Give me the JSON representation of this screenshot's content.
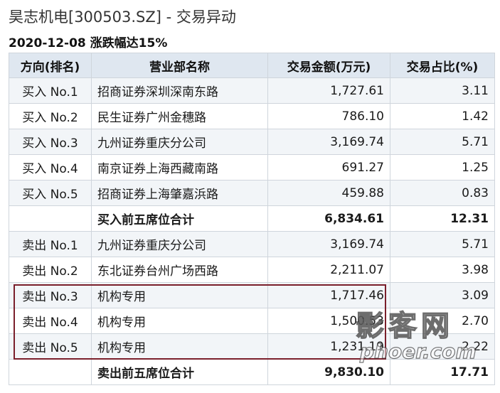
{
  "header": {
    "title": "昊志机电[300503.SZ] - 交易异动",
    "subtitle": "2020-12-08 涨跌幅达15%"
  },
  "table": {
    "columns": [
      "方向(排名)",
      "营业部名称",
      "交易金额(万元)",
      "交易占比(%)"
    ],
    "rows": [
      {
        "direction": "买入 No.1",
        "branch": "招商证券深圳深南东路",
        "amount": "1,727.61",
        "ratio": "3.11"
      },
      {
        "direction": "买入 No.2",
        "branch": "民生证券广州金穗路",
        "amount": "786.10",
        "ratio": "1.42"
      },
      {
        "direction": "买入 No.3",
        "branch": "九州证券重庆分公司",
        "amount": "3,169.74",
        "ratio": "5.71"
      },
      {
        "direction": "买入 No.4",
        "branch": "南京证券上海西藏南路",
        "amount": "691.27",
        "ratio": "1.25"
      },
      {
        "direction": "买入 No.5",
        "branch": "招商证券上海肇嘉浜路",
        "amount": "459.88",
        "ratio": "0.83"
      },
      {
        "direction": "",
        "branch": "买入前五席位合计",
        "amount": "6,834.61",
        "ratio": "12.31",
        "total": true
      },
      {
        "direction": "卖出 No.1",
        "branch": "九州证券重庆分公司",
        "amount": "3,169.74",
        "ratio": "5.71"
      },
      {
        "direction": "卖出 No.2",
        "branch": "东北证券台州广场西路",
        "amount": "2,211.07",
        "ratio": "3.98"
      },
      {
        "direction": "卖出 No.3",
        "branch": "机构专用",
        "amount": "1,717.46",
        "ratio": "3.09"
      },
      {
        "direction": "卖出 No.4",
        "branch": "机构专用",
        "amount": "1,500.53",
        "ratio": "2.70"
      },
      {
        "direction": "卖出 No.5",
        "branch": "机构专用",
        "amount": "1,231.19",
        "ratio": "2.22"
      },
      {
        "direction": "",
        "branch": "卖出前五席位合计",
        "amount": "9,830.10",
        "ratio": "17.71",
        "total": true
      }
    ]
  },
  "watermark": {
    "main": "影客网",
    "sub": "phoer.com"
  },
  "colors": {
    "header_bg": "#dfe7f0",
    "stripe_bg": "#f2f5f8",
    "highlight_border": "#7a1f2b"
  }
}
